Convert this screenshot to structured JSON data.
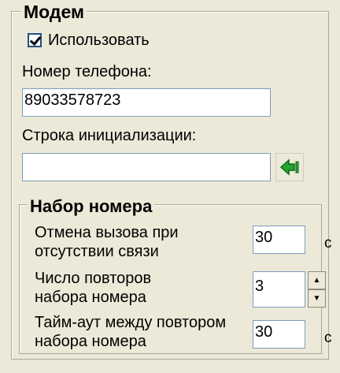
{
  "modem": {
    "title": "Модем",
    "use_checkbox": {
      "label": "Использовать",
      "checked": true
    },
    "phone_label": "Номер телефона:",
    "phone_value": "89033578723",
    "init_label": "Строка инициализации:",
    "init_value": "",
    "apply_icon": "green-left-arrow-icon"
  },
  "dialing": {
    "title": "Набор номера",
    "cancel_line1": "Отмена вызова при",
    "cancel_line2": "отсутствии связи",
    "cancel_value": "30",
    "cancel_unit": "с",
    "retries_line1": "Число повторов",
    "retries_line2": "набора номера",
    "retries_value": "3",
    "timeout_line1": "Тайм-аут между повтором",
    "timeout_line2": "набора номера",
    "timeout_value": "30",
    "timeout_unit": "с"
  },
  "colors": {
    "window_bg": "#ece9d8",
    "input_border": "#7f9db9",
    "arrow_green": "#26a32f"
  }
}
